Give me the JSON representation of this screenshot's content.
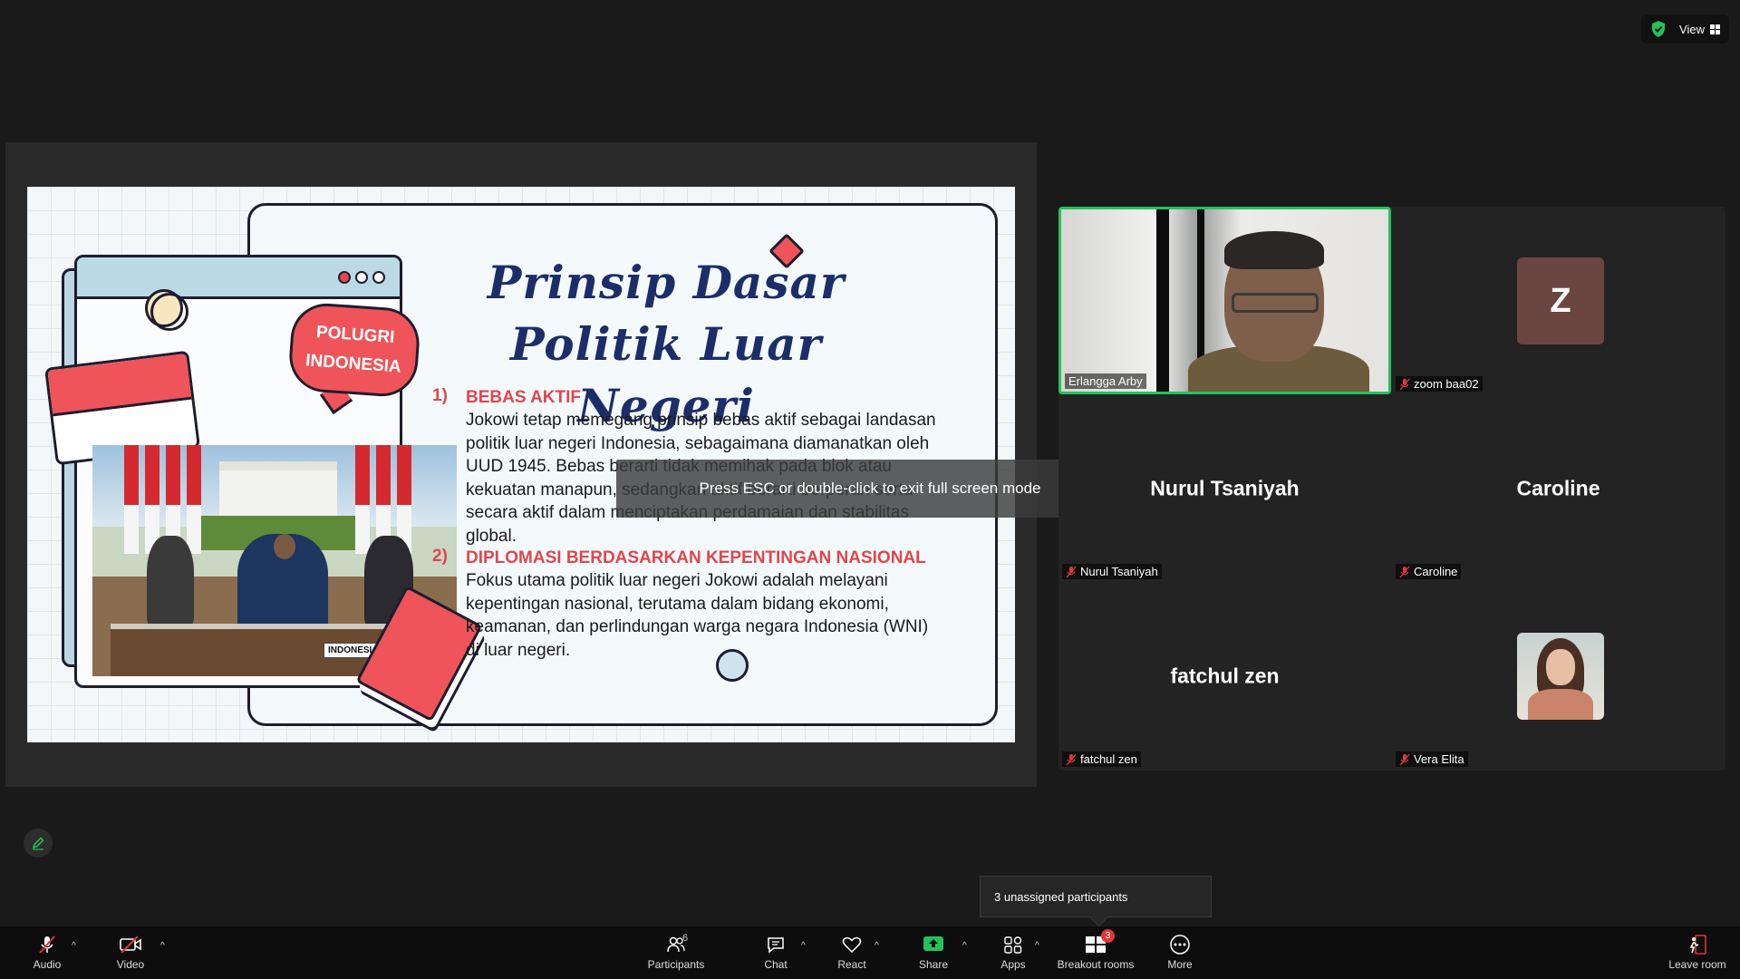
{
  "top": {
    "view_label": "View"
  },
  "slide": {
    "bubble_line1": "POLUGRI",
    "bubble_line2": "INDONESIA",
    "title_line1": "Prinsip Dasar",
    "title_line2": "Politik Luar Negeri",
    "photo_sign": "INDONESIA",
    "points": [
      {
        "num": "1)",
        "heading": "BEBAS AKTIF",
        "body": "Jokowi tetap memegang prinsip bebas aktif sebagai landasan politik luar negeri Indonesia, sebagaimana diamanatkan oleh UUD 1945. Bebas berarti tidak memihak pada blok atau kekuatan manapun, sedangkan aktif berarti berperan serta secara aktif dalam menciptakan perdamaian dan stabilitas global."
      },
      {
        "num": "2)",
        "heading": "DIPLOMASI BERDASARKAN KEPENTINGAN NASIONAL",
        "body": "Fokus utama politik luar negeri Jokowi adalah melayani kepentingan nasional, terutama dalam bidang ekonomi, keamanan, dan perlindungan warga negara Indonesia (WNI) di luar negeri."
      }
    ]
  },
  "toast": "Press ESC or double-click to exit full screen mode",
  "gallery": {
    "tiles": [
      {
        "label": "Erlangga Arby"
      },
      {
        "label": "zoom baa02",
        "initial": "Z"
      },
      {
        "label": "Nurul Tsaniyah",
        "center": "Nurul Tsaniyah"
      },
      {
        "label": "Caroline",
        "center": "Caroline"
      },
      {
        "label": "fatchul zen",
        "center": "fatchul zen"
      },
      {
        "label": "Vera Elita"
      }
    ]
  },
  "breakout_tooltip": "3 unassigned participants",
  "toolbar": {
    "audio": "Audio",
    "video": "Video",
    "participants": "Participants",
    "participants_count": "6",
    "chat": "Chat",
    "react": "React",
    "share": "Share",
    "apps": "Apps",
    "breakout": "Breakout rooms",
    "breakout_badge": "3",
    "more": "More",
    "leave": "Leave room"
  },
  "colors": {
    "accent_green": "#23c25c",
    "slide_red": "#e0464d",
    "title_navy": "#1d2d6a",
    "toolbar_bg": "#0d0d0d"
  }
}
